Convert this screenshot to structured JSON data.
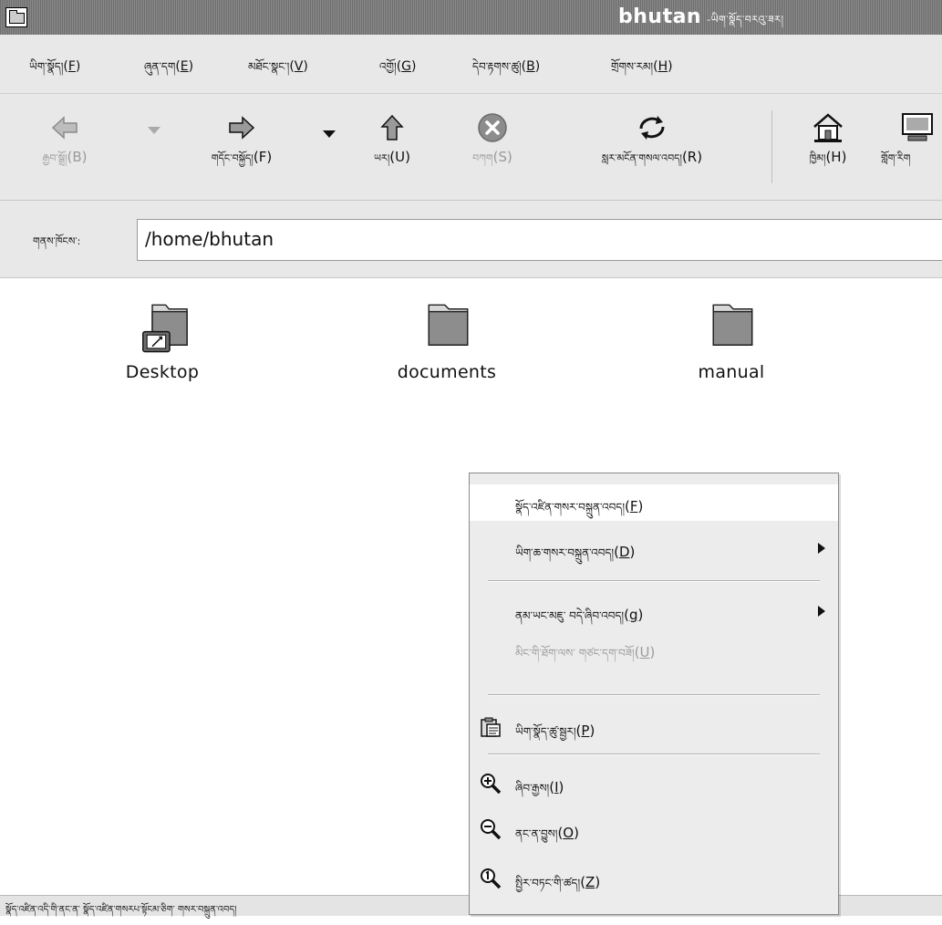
{
  "window": {
    "title": "bhutan",
    "title_suffix": " -ཡིག་སྣོད་བརའུ་ཟར།"
  },
  "menubar": {
    "items": [
      {
        "label": "ཡིག་སྣོད།",
        "mnemonic": "F"
      },
      {
        "label": "ཞུན་དག",
        "mnemonic": "E"
      },
      {
        "label": "མཐོང་སྣང་།",
        "mnemonic": "V"
      },
      {
        "label": "འགྱོ།",
        "mnemonic": "G"
      },
      {
        "label": "དེབ་རྟགས་ཚུ།",
        "mnemonic": "B"
      },
      {
        "label": "གྲོགས་རམ།",
        "mnemonic": "H"
      }
    ]
  },
  "toolbar": {
    "back": {
      "label": "རྒྱབ་སྒྲོ།",
      "shortcut": "(B)"
    },
    "forward": {
      "label": "གདོང་བསྐྱོད།",
      "shortcut": "(F)"
    },
    "up": {
      "label": "ཡར།",
      "shortcut": "(U)"
    },
    "stop": {
      "label": "བཀག",
      "shortcut": "(S)"
    },
    "reload": {
      "label": "སླར་མངོན་གསལ་འབད།",
      "shortcut": "(R)"
    },
    "home": {
      "label": "ཁྱིམ།",
      "shortcut": "(H)"
    },
    "computer": {
      "label": "གློག་རིག"
    }
  },
  "location": {
    "label": "གནས་ཁོངས་:",
    "value": "/home/bhutan"
  },
  "files": [
    {
      "name": "Desktop"
    },
    {
      "name": "documents"
    },
    {
      "name": "manual"
    }
  ],
  "context_menu": {
    "items": [
      {
        "label": "སྣོད་འཛིན་གསར་བསྐྲུན་འབད།",
        "mnemonic": "F",
        "enabled": true,
        "highlighted": true
      },
      {
        "label": "ཡིག་ཆ་གསར་བསྐྲུན་འབད།",
        "mnemonic": "D",
        "enabled": true,
        "submenu": true
      },
      {
        "label": "ནམ་ཡང་མཇུ་ བདེ་ཞིབ་འབད།",
        "mnemonic": "g",
        "enabled": true,
        "submenu": true
      },
      {
        "label": "མིང་གི་ཐོག་ལས་ གཙང་དག་བཟོ།",
        "mnemonic": "U",
        "enabled": false
      },
      {
        "label": "ཡིག་སྣོད་ཚུ་སྦྱར།",
        "mnemonic": "P",
        "enabled": true,
        "icon": "paste-icon"
      },
      {
        "label": "ཞིབ་རྒྱས།",
        "mnemonic": "I",
        "enabled": true,
        "icon": "zoom-in-icon"
      },
      {
        "label": "ནང་ན་བྱུས།",
        "mnemonic": "O",
        "enabled": true,
        "icon": "zoom-out-icon"
      },
      {
        "label": "སྤྱིར་བཏང་གི་ཚད།",
        "mnemonic": "Z",
        "enabled": true,
        "icon": "zoom-normal-icon"
      }
    ]
  },
  "status": {
    "text": "སྣོད་འཛིན་འདི་གི་ནང་ན་ སྣོད་འཛིན་གསརཔ་སྟོངམ་ཅིག་ གསར་བསྐྲུན་འབད།"
  }
}
